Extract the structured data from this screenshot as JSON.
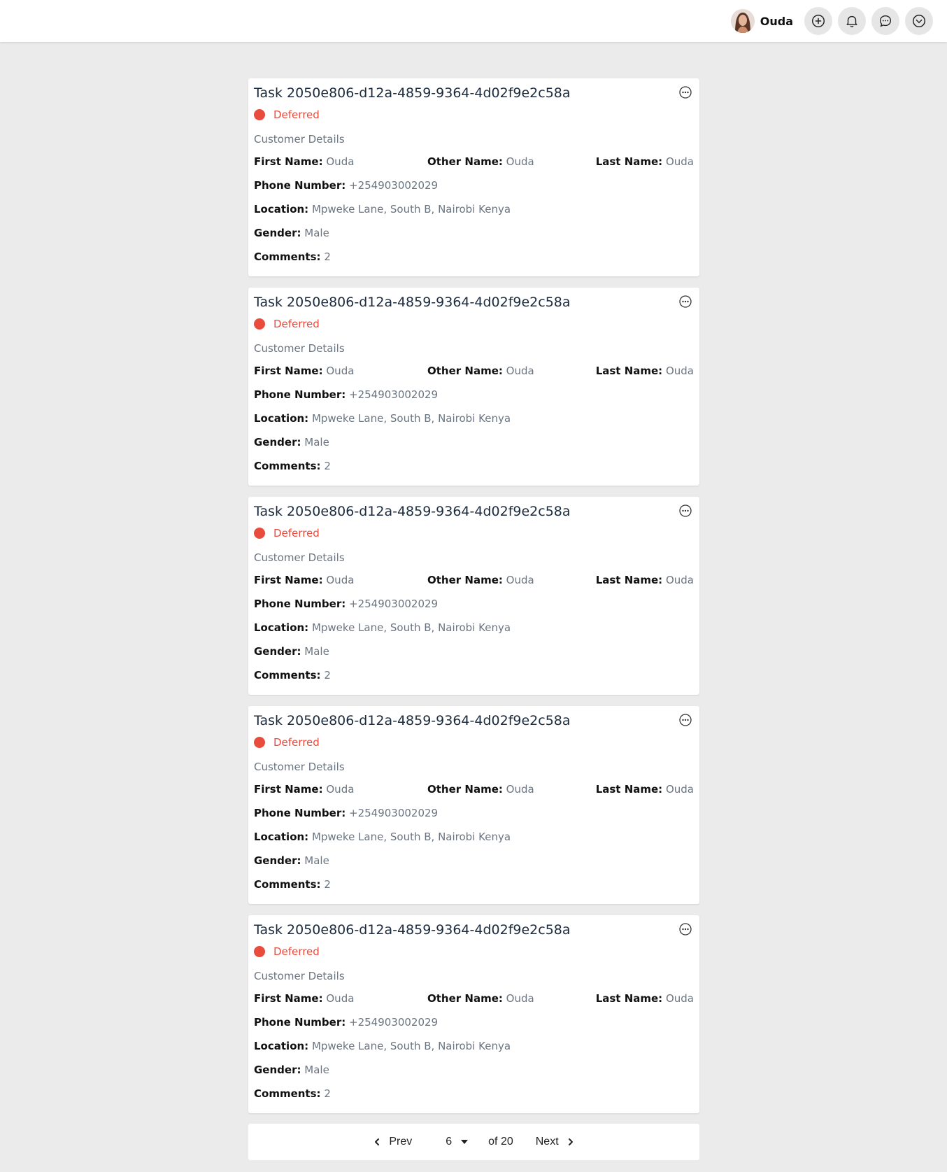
{
  "header": {
    "username": "Ouda",
    "icons": [
      "add-circle-icon",
      "bell-icon",
      "chat-icon",
      "chevron-down-circle-icon"
    ]
  },
  "colors": {
    "status_deferred": "#e94b3c",
    "title": "#1c2b3d",
    "muted": "#6b7581",
    "background": "#ebebeb"
  },
  "tasks": [
    {
      "title": "Task 2050e806-d12a-4859-9364-4d02f9e2c58a",
      "status": "Deferred",
      "section": "Customer Details",
      "first_name_label": "First Name:",
      "first_name": "Ouda",
      "other_name_label": "Other Name:",
      "other_name": "Ouda",
      "last_name_label": "Last Name:",
      "last_name": "Ouda",
      "phone_label": "Phone Number:",
      "phone": "+254903002029",
      "location_label": "Location:",
      "location": "Mpweke Lane, South B, Nairobi Kenya",
      "gender_label": "Gender:",
      "gender": "Male",
      "comments_label": "Comments:",
      "comments": "2"
    },
    {
      "title": "Task 2050e806-d12a-4859-9364-4d02f9e2c58a",
      "status": "Deferred",
      "section": "Customer Details",
      "first_name_label": "First Name:",
      "first_name": "Ouda",
      "other_name_label": "Other Name:",
      "other_name": "Ouda",
      "last_name_label": "Last Name:",
      "last_name": "Ouda",
      "phone_label": "Phone Number:",
      "phone": "+254903002029",
      "location_label": "Location:",
      "location": "Mpweke Lane, South B, Nairobi Kenya",
      "gender_label": "Gender:",
      "gender": "Male",
      "comments_label": "Comments:",
      "comments": "2"
    },
    {
      "title": "Task 2050e806-d12a-4859-9364-4d02f9e2c58a",
      "status": "Deferred",
      "section": "Customer Details",
      "first_name_label": "First Name:",
      "first_name": "Ouda",
      "other_name_label": "Other Name:",
      "other_name": "Ouda",
      "last_name_label": "Last Name:",
      "last_name": "Ouda",
      "phone_label": "Phone Number:",
      "phone": "+254903002029",
      "location_label": "Location:",
      "location": "Mpweke Lane, South B, Nairobi Kenya",
      "gender_label": "Gender:",
      "gender": "Male",
      "comments_label": "Comments:",
      "comments": "2"
    },
    {
      "title": "Task 2050e806-d12a-4859-9364-4d02f9e2c58a",
      "status": "Deferred",
      "section": "Customer Details",
      "first_name_label": "First Name:",
      "first_name": "Ouda",
      "other_name_label": "Other Name:",
      "other_name": "Ouda",
      "last_name_label": "Last Name:",
      "last_name": "Ouda",
      "phone_label": "Phone Number:",
      "phone": "+254903002029",
      "location_label": "Location:",
      "location": "Mpweke Lane, South B, Nairobi Kenya",
      "gender_label": "Gender:",
      "gender": "Male",
      "comments_label": "Comments:",
      "comments": "2"
    },
    {
      "title": "Task 2050e806-d12a-4859-9364-4d02f9e2c58a",
      "status": "Deferred",
      "section": "Customer Details",
      "first_name_label": "First Name:",
      "first_name": "Ouda",
      "other_name_label": "Other Name:",
      "other_name": "Ouda",
      "last_name_label": "Last Name:",
      "last_name": "Ouda",
      "phone_label": "Phone Number:",
      "phone": "+254903002029",
      "location_label": "Location:",
      "location": "Mpweke Lane, South B, Nairobi Kenya",
      "gender_label": "Gender:",
      "gender": "Male",
      "comments_label": "Comments:",
      "comments": "2"
    }
  ],
  "pagination": {
    "prev_label": "Prev",
    "current_page": "6",
    "of_text": "of 20",
    "next_label": "Next"
  }
}
